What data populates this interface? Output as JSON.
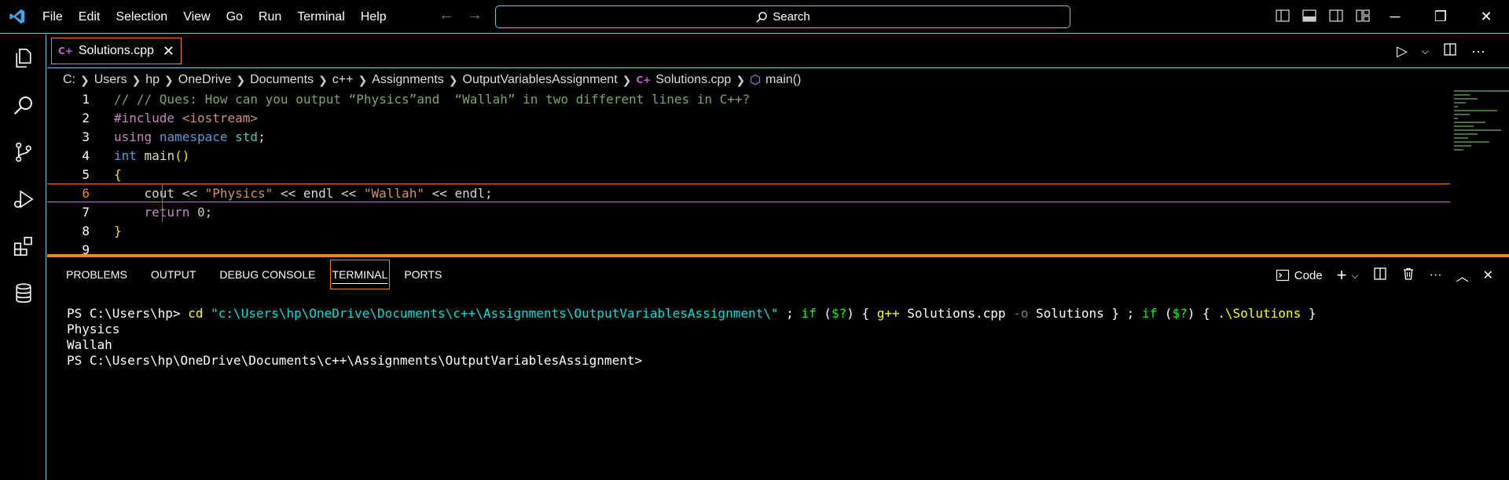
{
  "titlebar": {
    "menu": [
      "File",
      "Edit",
      "Selection",
      "View",
      "Go",
      "Run",
      "Terminal",
      "Help"
    ],
    "search_label": "Search"
  },
  "tab": {
    "badge": "C+",
    "label": "Solutions.cpp",
    "close": "✕"
  },
  "breadcrumb": {
    "items": [
      "C:",
      "Users",
      "hp",
      "OneDrive",
      "Documents",
      "c++",
      "Assignments",
      "OutputVariablesAssignment"
    ],
    "file": "Solutions.cpp",
    "symbol": "main()"
  },
  "editor": {
    "line_numbers": [
      "1",
      "2",
      "3",
      "4",
      "5",
      "6",
      "7",
      "8",
      "9"
    ],
    "active_line": 6,
    "lines": [
      [
        {
          "t": "// // Ques: How can you output “Physics”and  “Wallah” in two different lines in C++?",
          "c": "c-com"
        }
      ],
      [
        {
          "t": "#include ",
          "c": "c-pre"
        },
        {
          "t": "<iostream>",
          "c": "c-str"
        }
      ],
      [
        {
          "t": "using",
          "c": "c-pre"
        },
        {
          "t": " ",
          "c": "c-def"
        },
        {
          "t": "namespace",
          "c": "c-kw"
        },
        {
          "t": " ",
          "c": "c-def"
        },
        {
          "t": "std",
          "c": "c-ty"
        },
        {
          "t": ";",
          "c": "c-def"
        }
      ],
      [
        {
          "t": "int",
          "c": "c-kw"
        },
        {
          "t": " ",
          "c": "c-def"
        },
        {
          "t": "main",
          "c": "c-fn"
        },
        {
          "t": "()",
          "c": "c-br"
        }
      ],
      [
        {
          "t": "{",
          "c": "c-br"
        }
      ],
      [
        {
          "t": "    cout << ",
          "c": "c-def"
        },
        {
          "t": "\"Physics\"",
          "c": "c-str"
        },
        {
          "t": " << endl << ",
          "c": "c-def"
        },
        {
          "t": "\"Wallah\"",
          "c": "c-str"
        },
        {
          "t": " << endl;",
          "c": "c-def"
        }
      ],
      [
        {
          "t": "    ",
          "c": "c-def"
        },
        {
          "t": "return",
          "c": "c-pre"
        },
        {
          "t": " ",
          "c": "c-def"
        },
        {
          "t": "0",
          "c": "c-num"
        },
        {
          "t": ";",
          "c": "c-def"
        }
      ],
      [
        {
          "t": "}",
          "c": "c-br"
        }
      ],
      [
        {
          "t": "",
          "c": "c-def"
        }
      ]
    ]
  },
  "panel": {
    "tabs": [
      "PROBLEMS",
      "OUTPUT",
      "DEBUG CONSOLE",
      "TERMINAL",
      "PORTS"
    ],
    "active_tab": "TERMINAL",
    "terminal_profile": "Code"
  },
  "terminal": {
    "prompt1": "PS C:\\Users\\hp> ",
    "cmd_cd": "cd",
    "cd_path": "\"c:\\Users\\hp\\OneDrive\\Documents\\c++\\Assignments\\OutputVariablesAssignment\\\"",
    "semi1": " ; ",
    "if1": "if",
    "cond1_open": " (",
    "var1": "$?",
    "cond1_close": ") { ",
    "gpp": "g++",
    "gpp_file": " Solutions.cpp ",
    "gpp_flag": "-o",
    "gpp_out": " Solutions",
    "close1": " } ; ",
    "if2": "if",
    "cond2_open": " (",
    "var2": "$?",
    "cond2_close": ") { ",
    "run_exe": ".\\Solutions",
    "close2": " }",
    "output1": "Physics",
    "output2": "Wallah",
    "prompt2": "PS C:\\Users\\hp\\OneDrive\\Documents\\c++\\Assignments\\OutputVariablesAssignment>"
  },
  "colors": {
    "accent_border": "#6fc3df",
    "active_orange": "#f38518"
  }
}
